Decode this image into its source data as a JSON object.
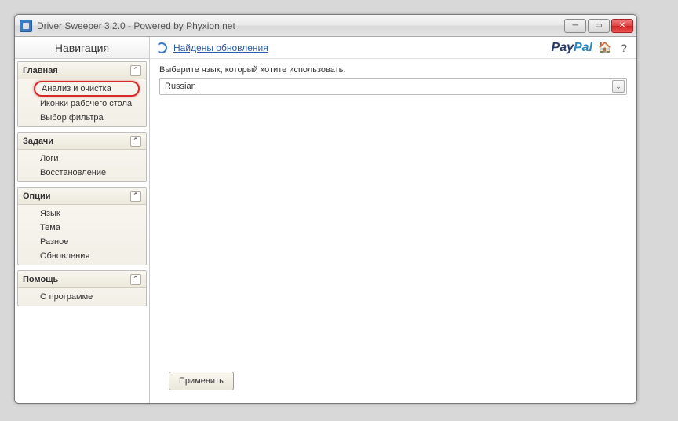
{
  "window": {
    "title": "Driver Sweeper 3.2.0 - Powered by Phyxion.net"
  },
  "sidebar": {
    "title": "Навигация",
    "groups": [
      {
        "label": "Главная",
        "items": [
          "Анализ и очистка",
          "Иконки рабочего стола",
          "Выбор фильтра"
        ]
      },
      {
        "label": "Задачи",
        "items": [
          "Логи",
          "Восстановление"
        ]
      },
      {
        "label": "Опции",
        "items": [
          "Язык",
          "Тема",
          "Разное",
          "Обновления"
        ]
      },
      {
        "label": "Помощь",
        "items": [
          "О программе"
        ]
      }
    ]
  },
  "topbar": {
    "update_link": "Найдены обновления",
    "paypal_pay": "Pay",
    "paypal_pal": "Pal"
  },
  "content": {
    "label": "Выберите язык, который хотите использовать:",
    "selected_value": "Russian"
  },
  "footer": {
    "apply": "Применить"
  }
}
